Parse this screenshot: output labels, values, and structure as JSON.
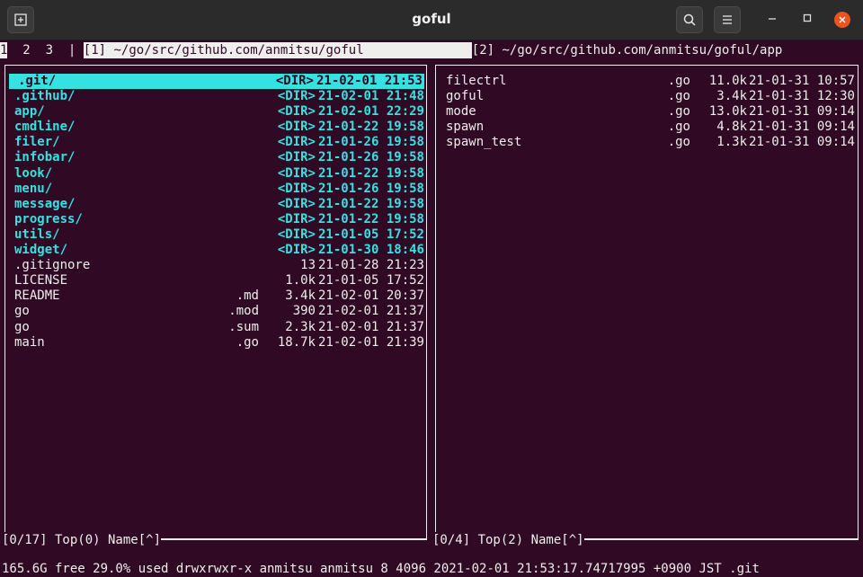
{
  "window": {
    "title": "goful",
    "new_tab_icon": "new-tab-icon",
    "search_icon": "search-icon",
    "menu_icon": "hamburger-menu-icon",
    "minimize_icon": "minimize-icon",
    "maximize_icon": "maximize-icon",
    "close_icon": "close-icon"
  },
  "tabs": [
    "1",
    "2",
    "3"
  ],
  "tab_separator": "|",
  "panes": {
    "left_path": "[1] ~/go/src/github.com/anmitsu/goful",
    "right_path": "[2] ~/go/src/github.com/anmitsu/goful/app"
  },
  "left_files": [
    {
      "name": ".git/",
      "ext": "",
      "size": "<DIR>",
      "date": "21-02-01 21:53",
      "dir": true,
      "selected": true
    },
    {
      "name": ".github/",
      "ext": "",
      "size": "<DIR>",
      "date": "21-02-01 21:48",
      "dir": true
    },
    {
      "name": "app/",
      "ext": "",
      "size": "<DIR>",
      "date": "21-02-01 22:29",
      "dir": true
    },
    {
      "name": "cmdline/",
      "ext": "",
      "size": "<DIR>",
      "date": "21-01-22 19:58",
      "dir": true
    },
    {
      "name": "filer/",
      "ext": "",
      "size": "<DIR>",
      "date": "21-01-26 19:58",
      "dir": true
    },
    {
      "name": "infobar/",
      "ext": "",
      "size": "<DIR>",
      "date": "21-01-26 19:58",
      "dir": true
    },
    {
      "name": "look/",
      "ext": "",
      "size": "<DIR>",
      "date": "21-01-22 19:58",
      "dir": true
    },
    {
      "name": "menu/",
      "ext": "",
      "size": "<DIR>",
      "date": "21-01-26 19:58",
      "dir": true
    },
    {
      "name": "message/",
      "ext": "",
      "size": "<DIR>",
      "date": "21-01-22 19:58",
      "dir": true
    },
    {
      "name": "progress/",
      "ext": "",
      "size": "<DIR>",
      "date": "21-01-22 19:58",
      "dir": true
    },
    {
      "name": "utils/",
      "ext": "",
      "size": "<DIR>",
      "date": "21-01-05 17:52",
      "dir": true
    },
    {
      "name": "widget/",
      "ext": "",
      "size": "<DIR>",
      "date": "21-01-30 18:46",
      "dir": true
    },
    {
      "name": ".gitignore",
      "ext": "",
      "size": "13",
      "date": "21-01-28 21:23"
    },
    {
      "name": "LICENSE",
      "ext": "",
      "size": "1.0k",
      "date": "21-01-05 17:52"
    },
    {
      "name": "README",
      "ext": ".md",
      "size": "3.4k",
      "date": "21-02-01 20:37"
    },
    {
      "name": "go",
      "ext": ".mod",
      "size": "390",
      "date": "21-02-01 21:37"
    },
    {
      "name": "go",
      "ext": ".sum",
      "size": "2.3k",
      "date": "21-02-01 21:37"
    },
    {
      "name": "main",
      "ext": ".go",
      "size": "18.7k",
      "date": "21-02-01 21:39"
    }
  ],
  "right_files": [
    {
      "name": "filectrl",
      "ext": ".go",
      "size": "11.0k",
      "date": "21-01-31 10:57"
    },
    {
      "name": "goful",
      "ext": ".go",
      "size": "3.4k",
      "date": "21-01-31 12:30"
    },
    {
      "name": "mode",
      "ext": ".go",
      "size": "13.0k",
      "date": "21-01-31 09:14"
    },
    {
      "name": "spawn",
      "ext": ".go",
      "size": "4.8k",
      "date": "21-01-31 09:14"
    },
    {
      "name": "spawn_test",
      "ext": ".go",
      "size": "1.3k",
      "date": "21-01-31 09:14"
    }
  ],
  "footers": {
    "left": "[0/17] Top(0) Name[^]",
    "right": "[0/4] Top(2) Name[^]"
  },
  "status": "165.6G free 29.0% used drwxrwxr-x anmitsu anmitsu 8 4096 2021-02-01 21:53:17.74717995 +0900 JST .git",
  "colors": {
    "background": "#300a24",
    "foreground": "#eeeeec",
    "directory": "#34e2e2",
    "titlebar": "#2b2b2b",
    "close_button": "#e95420"
  }
}
